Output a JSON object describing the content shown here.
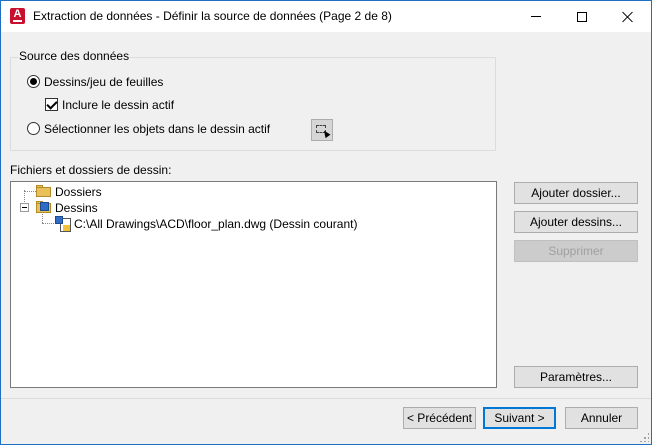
{
  "window": {
    "title": "Extraction de données - Définir la source de données (Page 2 de 8)"
  },
  "source_group": {
    "title": "Source des données",
    "options": [
      {
        "label": "Dessins/jeu de feuilles",
        "selected": true
      },
      {
        "label": "Sélectionner les objets dans le dessin actif",
        "selected": false
      }
    ],
    "include_current": {
      "label": "Inclure le dessin actif",
      "checked": true
    }
  },
  "files_section": {
    "label": "Fichiers et dossiers de dessin:",
    "tree": [
      {
        "label": "Dossiers",
        "icon": "folder-icon"
      },
      {
        "label": "Dessins",
        "icon": "drawings-folder-icon",
        "expanded": true,
        "children": [
          {
            "label": "C:\\All Drawings\\ACD\\floor_plan.dwg (Dessin courant)",
            "icon": "dwg-file-icon"
          }
        ]
      }
    ]
  },
  "side_buttons": {
    "add_folder": "Ajouter dossier...",
    "add_drawings": "Ajouter dessins...",
    "remove": "Supprimer",
    "settings": "Paramètres..."
  },
  "footer": {
    "back": "< Précédent",
    "next": "Suivant >",
    "cancel": "Annuler"
  }
}
